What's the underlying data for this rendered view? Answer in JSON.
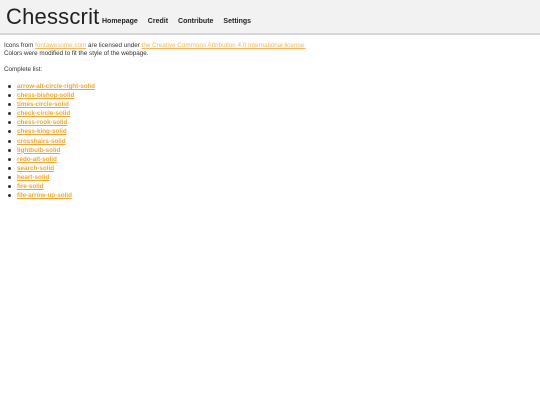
{
  "header": {
    "brand": "Chesscrit",
    "nav": {
      "homepage": "Homepage",
      "credit": "Credit",
      "contribute": "Contribute",
      "settings": "Settings"
    }
  },
  "content": {
    "line1_prefix": "Icons from",
    "fontawesome_link": "fontawesome.com",
    "line1_middle": "are licensed under",
    "license_link": "the Creative Commons Attribution 4.0 International license.",
    "line2": "Colors were modified to fit the style of the webpage.",
    "complete_list_label": "Complete list:",
    "icons": [
      "arrow-alt-circle-right-solid",
      "chess-bishop-solid",
      "times-circle-solid",
      "check-circle-solid",
      "chess-rook-solid",
      "chess-king-solid",
      "crosshairs-solid",
      "lightbulb-solid",
      "redo-alt-solid",
      "search-solid",
      "heart-solid",
      "fire-solid",
      "file-arrow-up-solid"
    ]
  },
  "colors": {
    "header_bg": "#f2f2f2",
    "link_accent": "#f0a630",
    "external_link": "#f5b75a"
  }
}
